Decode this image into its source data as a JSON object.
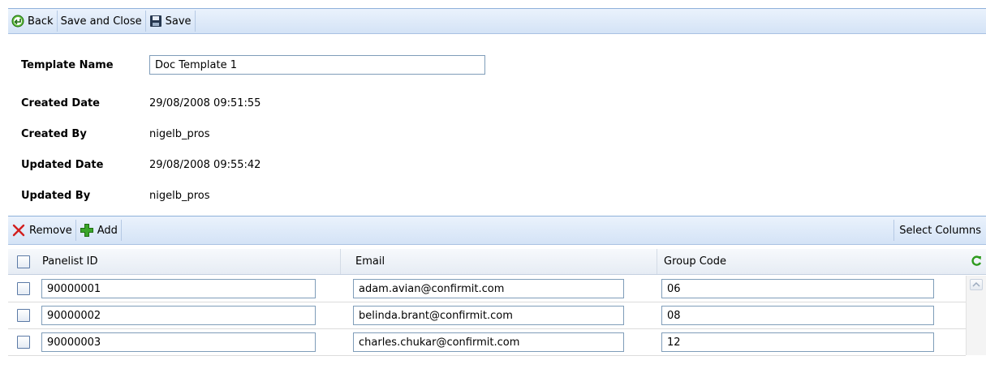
{
  "colors": {
    "toolbar_border": "#8fb1da",
    "toolbar_bg": "#d4e3f6",
    "input_border": "#7f9db9",
    "accent_green": "#2e9b1e",
    "remove_red": "#d21e1e"
  },
  "toolbar": {
    "back_label": "Back",
    "save_close_label": "Save and Close",
    "save_label": "Save",
    "icons": [
      "back-arrow-icon",
      "floppy-disk-icon"
    ]
  },
  "details": {
    "template_name": {
      "label": "Template Name",
      "value": "Doc Template 1"
    },
    "created_date": {
      "label": "Created Date",
      "value": "29/08/2008 09:51:55"
    },
    "created_by": {
      "label": "Created By",
      "value": "nigelb_pros"
    },
    "updated_date": {
      "label": "Updated Date",
      "value": "29/08/2008 09:55:42"
    },
    "updated_by": {
      "label": "Updated By",
      "value": "nigelb_pros"
    }
  },
  "grid_toolbar": {
    "remove_label": "Remove",
    "add_label": "Add",
    "select_columns_label": "Select Columns",
    "icons": [
      "remove-x-icon",
      "add-plus-icon"
    ]
  },
  "grid": {
    "columns": [
      "Panelist ID",
      "Email",
      "Group Code"
    ],
    "rows": [
      {
        "panelist_id": "90000001",
        "email": "adam.avian@confirmit.com",
        "group_code": "06"
      },
      {
        "panelist_id": "90000002",
        "email": "belinda.brant@confirmit.com",
        "group_code": "08"
      },
      {
        "panelist_id": "90000003",
        "email": "charles.chukar@confirmit.com",
        "group_code": "12"
      }
    ],
    "icons": [
      "refresh-icon",
      "scroll-up-arrow-icon"
    ]
  }
}
